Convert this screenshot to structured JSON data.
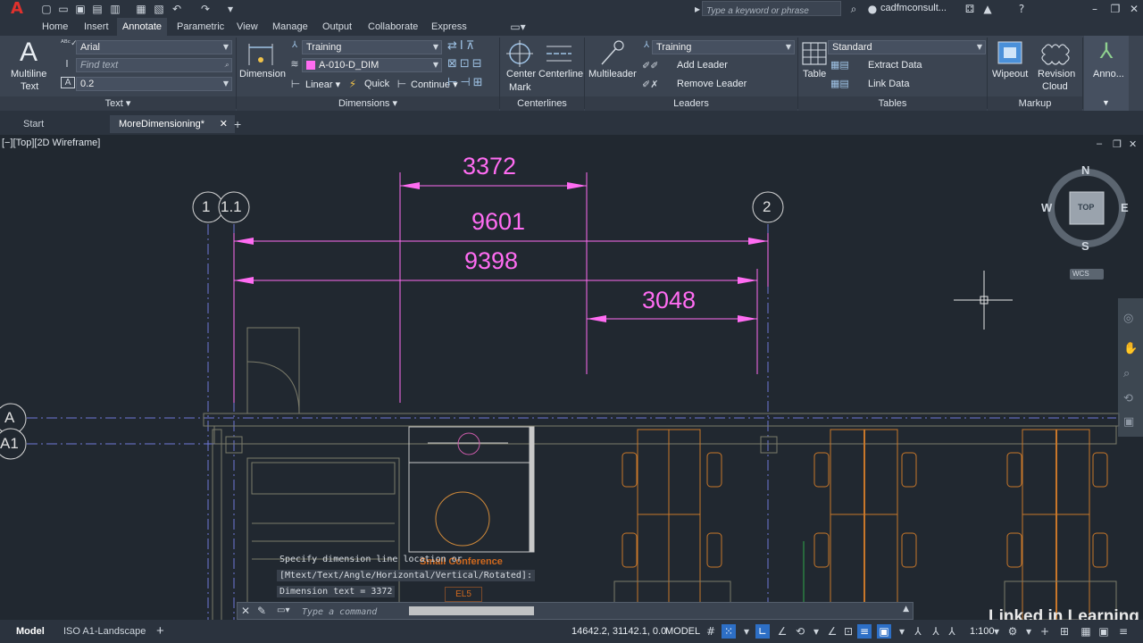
{
  "app": {
    "logo": "A"
  },
  "titlebar": {
    "search_placeholder": "Type a keyword or phrase",
    "user": "cadfmconsult...",
    "qa_icons": [
      "new-icon",
      "open-icon",
      "save-icon",
      "saveas-icon",
      "web-icon",
      "print-icon",
      "undo-icon",
      "redo-icon",
      "more-icon"
    ]
  },
  "ribbon_tabs": [
    "Home",
    "Insert",
    "Annotate",
    "Parametric",
    "View",
    "Manage",
    "Output",
    "Collaborate",
    "Express Tools"
  ],
  "ribbon": {
    "text": {
      "multiline_label_1": "Multiline",
      "multiline_label_2": "Text",
      "font": "Arial",
      "find_placeholder": "Find text",
      "height": "0.2",
      "title": "Text"
    },
    "dimensions": {
      "dimension_label": "Dimension",
      "style": "Training",
      "layer": "A-010-D_DIM",
      "linear": "Linear",
      "quick": "Quick",
      "continue": "Continue",
      "title": "Dimensions"
    },
    "centerlines": {
      "center_mark_1": "Center",
      "center_mark_2": "Mark",
      "centerline": "Centerline",
      "title": "Centerlines"
    },
    "leaders": {
      "multileader": "Multileader",
      "style": "Training",
      "add_leader": "Add Leader",
      "remove_leader": "Remove Leader",
      "title": "Leaders"
    },
    "tables": {
      "table": "Table",
      "style": "Standard",
      "extract": "Extract Data",
      "link": "Link Data",
      "title": "Tables"
    },
    "markup": {
      "wipeout": "Wipeout",
      "revision_1": "Revision",
      "revision_2": "Cloud",
      "title": "Markup"
    },
    "anno": {
      "label": "Anno..."
    }
  },
  "file_tabs": [
    "Start",
    "MoreDimensioning*"
  ],
  "viewport": {
    "label": "[−][Top][2D Wireframe]"
  },
  "drawing": {
    "dims": [
      "3372",
      "9601",
      "9398",
      "3048"
    ],
    "grid_cols": [
      "1",
      "1.1",
      "2"
    ],
    "grid_rows": [
      "A",
      "A1"
    ],
    "room_label": "Small Conference",
    "room_tag": "EL5"
  },
  "viewcube": {
    "n": "N",
    "s": "S",
    "e": "E",
    "w": "W",
    "top": "TOP",
    "wcs": "WCS"
  },
  "command": {
    "history": [
      "Specify dimension line location or",
      "[Mtext/Text/Angle/Horizontal/Vertical/Rotated]:",
      "Dimension text = 3372"
    ],
    "placeholder": "Type a command"
  },
  "status": {
    "model_tab": "Model",
    "layout_tab": "ISO A1-Landscape",
    "coords": "14642.2, 31142.1, 0.0",
    "space": "MODEL",
    "scale": "1:100"
  },
  "watermark": "Linked in Learning",
  "colors": {
    "dimension": "#ff6cf2",
    "linework": "#c8772a",
    "grid": "#6e78d8",
    "accent": "#e0312d"
  }
}
